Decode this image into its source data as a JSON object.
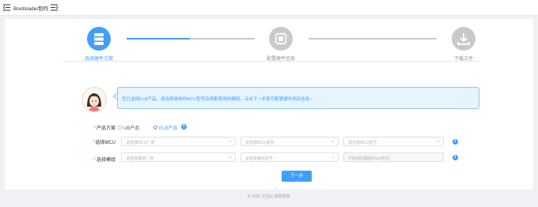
{
  "header": {
    "title": "Bootloader制作"
  },
  "steps": [
    {
      "label": "选择硬件方案",
      "active": true
    },
    {
      "label": "配置硬件信息",
      "active": false
    },
    {
      "label": "下载文件",
      "active": false
    }
  ],
  "tip": {
    "text": "您已选择ELB产品，请选择具体的MCU型号及搭配使用的模组，点击下一步即可配置硬件相关信息~"
  },
  "form": {
    "product_label": "产品方案",
    "product_options": [
      "UB产品",
      "ELB产品"
    ],
    "product_selected": "ELB产品",
    "mcu_label": "选择MCU",
    "mcu_vendor_placeholder": "请选择MCU厂商",
    "mcu_series_placeholder": "请选择MCU系列",
    "mcu_model_placeholder": "请选择MCU型号",
    "module_label": "选择模组",
    "module_vendor_placeholder": "请选择模组厂商",
    "module_model_placeholder": "请选择模组型号",
    "module_flash_placeholder": "不能用的模组Flash空间",
    "next_button": "下一步"
  },
  "footer": {
    "text": "© 2020 艾拉比 版权所有"
  },
  "colors": {
    "primary": "#409eff",
    "inactive_step": "#c8c9cc",
    "required": "#f56c6c"
  }
}
